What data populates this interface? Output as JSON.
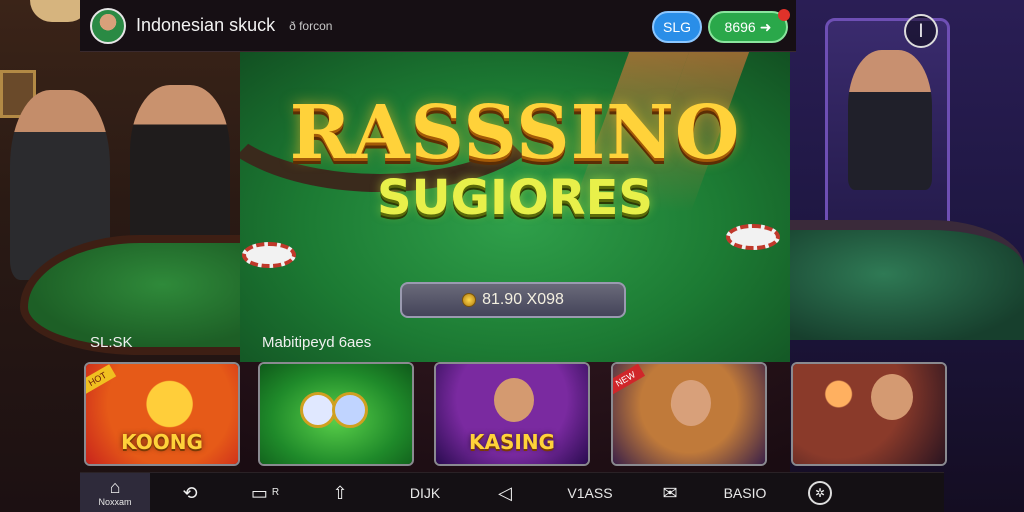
{
  "header": {
    "app_title": "Indonesian skuck",
    "subtitle": "ð forcon",
    "pill_blue": "SLG",
    "pill_green": "8696"
  },
  "hero": {
    "title_line1": "RASSSINO",
    "title_line2": "SUGIORES",
    "balance": "81.90 X098"
  },
  "sections": {
    "left_label": "SL:SK",
    "multiplayer_label": "Mabitipeyd 6aes"
  },
  "cards": [
    {
      "label": "KOONG",
      "ribbon": "HOT"
    },
    {
      "label": ""
    },
    {
      "label": "KASING"
    },
    {
      "label": "",
      "ribbon": "NEW"
    },
    {
      "label": ""
    }
  ],
  "nav": {
    "items": [
      {
        "icon": "home-icon",
        "label": "Noxxam"
      },
      {
        "icon": "refresh-icon",
        "label": ""
      },
      {
        "icon": "wallet-icon",
        "label": "R"
      },
      {
        "icon": "upload-icon",
        "label": ""
      },
      {
        "icon": "",
        "label": "DIJK"
      },
      {
        "icon": "back-icon",
        "label": ""
      },
      {
        "icon": "",
        "label": "V1ASS"
      },
      {
        "icon": "mail-icon",
        "label": ""
      },
      {
        "icon": "",
        "label": "BASIO"
      },
      {
        "icon": "settings-icon",
        "label": ""
      }
    ]
  },
  "colors": {
    "felt": "#1c7a33",
    "gold": "#ffd23a",
    "header_bg": "#160f14",
    "pill_blue": "#2a8ee8",
    "pill_green": "#2aa84a"
  }
}
